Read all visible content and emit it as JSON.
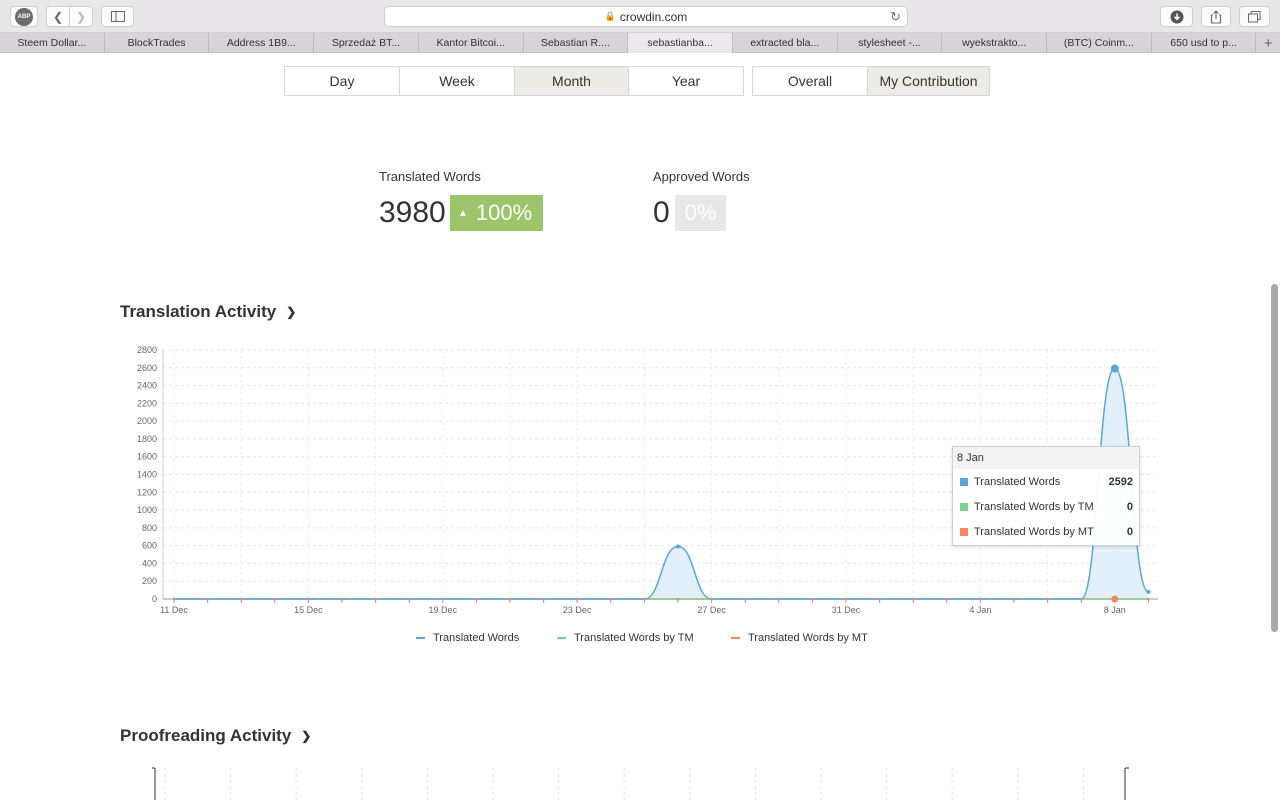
{
  "browser": {
    "url": "crowdin.com",
    "tabs": [
      {
        "label": "Steem Dollar..."
      },
      {
        "label": "BlockTrades"
      },
      {
        "label": "Address 1B9..."
      },
      {
        "label": "Sprzedaż BT..."
      },
      {
        "label": "Kantor Bitcoi..."
      },
      {
        "label": "Sebastian R...."
      },
      {
        "label": "sebastianba...",
        "active": true
      },
      {
        "label": "extracted bla..."
      },
      {
        "label": "stylesheet -..."
      },
      {
        "label": "wyekstrakto..."
      },
      {
        "label": "(BTC) Coinm..."
      },
      {
        "label": "650 usd to p..."
      }
    ],
    "new_tab": "+"
  },
  "periods": [
    "Day",
    "Week",
    "Month",
    "Year"
  ],
  "selected_period": "Month",
  "scope": [
    "Overall",
    "My Contribution"
  ],
  "selected_scope": "My Contribution",
  "stats": {
    "translated_label": "Translated Words",
    "translated_value": "3980",
    "translated_change": "100%",
    "approved_label": "Approved Words",
    "approved_value": "0",
    "approved_change": "0%"
  },
  "translation_section": {
    "title": "Translation Activity"
  },
  "proofreading_section": {
    "title": "Proofreading Activity"
  },
  "colors": {
    "translated": "#5aa6dc",
    "tm": "#7fd18f",
    "mt": "#ee8a5d",
    "badge_green": "#9bc46b"
  },
  "chart_data": {
    "type": "area",
    "x_tick_labels": [
      "11 Dec",
      "15 Dec",
      "19 Dec",
      "23 Dec",
      "27 Dec",
      "31 Dec",
      "4 Jan",
      "8 Jan"
    ],
    "ylim": [
      0,
      2800
    ],
    "y_ticks": [
      0,
      200,
      400,
      600,
      800,
      1000,
      1200,
      1400,
      1600,
      1800,
      2000,
      2200,
      2400,
      2600,
      2800
    ],
    "grid": true,
    "legend_position": "bottom",
    "x": [
      "11 Dec",
      "12 Dec",
      "13 Dec",
      "14 Dec",
      "15 Dec",
      "16 Dec",
      "17 Dec",
      "18 Dec",
      "19 Dec",
      "20 Dec",
      "21 Dec",
      "22 Dec",
      "23 Dec",
      "24 Dec",
      "25 Dec",
      "26 Dec",
      "27 Dec",
      "28 Dec",
      "29 Dec",
      "30 Dec",
      "31 Dec",
      "1 Jan",
      "2 Jan",
      "3 Jan",
      "4 Jan",
      "5 Jan",
      "6 Jan",
      "7 Jan",
      "8 Jan",
      "9 Jan"
    ],
    "series": [
      {
        "name": "Translated Words",
        "values": [
          0,
          0,
          0,
          0,
          0,
          0,
          0,
          0,
          0,
          0,
          0,
          0,
          0,
          0,
          0,
          590,
          0,
          0,
          0,
          0,
          0,
          0,
          0,
          0,
          0,
          0,
          0,
          0,
          2592,
          80
        ]
      },
      {
        "name": "Translated Words by TM",
        "values": [
          0,
          0,
          0,
          0,
          0,
          0,
          0,
          0,
          0,
          0,
          0,
          0,
          0,
          0,
          0,
          0,
          0,
          0,
          0,
          0,
          0,
          0,
          0,
          0,
          0,
          0,
          0,
          0,
          0,
          0
        ]
      },
      {
        "name": "Translated Words by MT",
        "values": [
          0,
          0,
          0,
          0,
          0,
          0,
          0,
          0,
          0,
          0,
          0,
          0,
          0,
          0,
          0,
          0,
          0,
          0,
          0,
          0,
          0,
          0,
          0,
          0,
          0,
          0,
          0,
          0,
          0,
          0
        ]
      }
    ],
    "tooltip": {
      "title": "8 Jan",
      "rows": [
        {
          "name": "Translated Words",
          "value": "2592"
        },
        {
          "name": "Translated Words by TM",
          "value": "0"
        },
        {
          "name": "Translated Words by MT",
          "value": "0"
        }
      ]
    }
  }
}
